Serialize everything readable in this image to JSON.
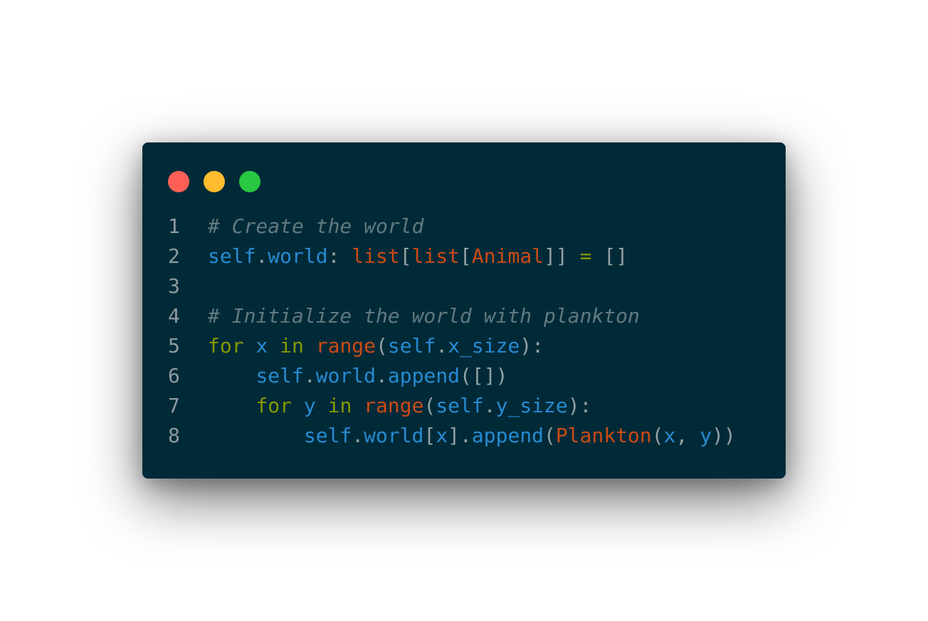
{
  "colors": {
    "window_bg": "#012a38",
    "close": "#ff5f57",
    "minimize": "#febc2e",
    "maximize": "#28c840",
    "line_number": "#8e9a9e",
    "comment": "#61797f",
    "identifier": "#268bd2",
    "punctuation": "#93a1a1",
    "keyword": "#859900",
    "builtin": "#cb4b16"
  },
  "window_controls": [
    {
      "name": "close-button",
      "icon": "red-circle-icon",
      "color": "#ff5f57"
    },
    {
      "name": "minimize-button",
      "icon": "yellow-circle-icon",
      "color": "#febc2e"
    },
    {
      "name": "maximize-button",
      "icon": "green-circle-icon",
      "color": "#28c840"
    }
  ],
  "lines": [
    {
      "num": "1",
      "tokens": [
        {
          "t": "# Create the world",
          "c": "comment"
        }
      ]
    },
    {
      "num": "2",
      "tokens": [
        {
          "t": "self",
          "c": "ident"
        },
        {
          "t": ".",
          "c": "punct"
        },
        {
          "t": "world",
          "c": "ident"
        },
        {
          "t": ": ",
          "c": "punct"
        },
        {
          "t": "list",
          "c": "builtin"
        },
        {
          "t": "[",
          "c": "punct"
        },
        {
          "t": "list",
          "c": "builtin"
        },
        {
          "t": "[",
          "c": "punct"
        },
        {
          "t": "Animal",
          "c": "builtin"
        },
        {
          "t": "]] ",
          "c": "punct"
        },
        {
          "t": "=",
          "c": "kw"
        },
        {
          "t": " []",
          "c": "punct"
        }
      ]
    },
    {
      "num": "3",
      "tokens": []
    },
    {
      "num": "4",
      "tokens": [
        {
          "t": "# Initialize the world with plankton",
          "c": "comment"
        }
      ]
    },
    {
      "num": "5",
      "tokens": [
        {
          "t": "for",
          "c": "kw"
        },
        {
          "t": " ",
          "c": "punct"
        },
        {
          "t": "x",
          "c": "ident"
        },
        {
          "t": " ",
          "c": "punct"
        },
        {
          "t": "in",
          "c": "kw"
        },
        {
          "t": " ",
          "c": "punct"
        },
        {
          "t": "range",
          "c": "builtin"
        },
        {
          "t": "(",
          "c": "punct"
        },
        {
          "t": "self",
          "c": "ident"
        },
        {
          "t": ".",
          "c": "punct"
        },
        {
          "t": "x_size",
          "c": "ident"
        },
        {
          "t": "):",
          "c": "punct"
        }
      ]
    },
    {
      "num": "6",
      "tokens": [
        {
          "t": "    ",
          "c": "punct"
        },
        {
          "t": "self",
          "c": "ident"
        },
        {
          "t": ".",
          "c": "punct"
        },
        {
          "t": "world",
          "c": "ident"
        },
        {
          "t": ".",
          "c": "punct"
        },
        {
          "t": "append",
          "c": "ident"
        },
        {
          "t": "([])",
          "c": "punct"
        }
      ]
    },
    {
      "num": "7",
      "tokens": [
        {
          "t": "    ",
          "c": "punct"
        },
        {
          "t": "for",
          "c": "kw"
        },
        {
          "t": " ",
          "c": "punct"
        },
        {
          "t": "y",
          "c": "ident"
        },
        {
          "t": " ",
          "c": "punct"
        },
        {
          "t": "in",
          "c": "kw"
        },
        {
          "t": " ",
          "c": "punct"
        },
        {
          "t": "range",
          "c": "builtin"
        },
        {
          "t": "(",
          "c": "punct"
        },
        {
          "t": "self",
          "c": "ident"
        },
        {
          "t": ".",
          "c": "punct"
        },
        {
          "t": "y_size",
          "c": "ident"
        },
        {
          "t": "):",
          "c": "punct"
        }
      ]
    },
    {
      "num": "8",
      "tokens": [
        {
          "t": "        ",
          "c": "punct"
        },
        {
          "t": "self",
          "c": "ident"
        },
        {
          "t": ".",
          "c": "punct"
        },
        {
          "t": "world",
          "c": "ident"
        },
        {
          "t": "[",
          "c": "punct"
        },
        {
          "t": "x",
          "c": "ident"
        },
        {
          "t": "].",
          "c": "punct"
        },
        {
          "t": "append",
          "c": "ident"
        },
        {
          "t": "(",
          "c": "punct"
        },
        {
          "t": "Plankton",
          "c": "builtin"
        },
        {
          "t": "(",
          "c": "punct"
        },
        {
          "t": "x",
          "c": "ident"
        },
        {
          "t": ", ",
          "c": "punct"
        },
        {
          "t": "y",
          "c": "ident"
        },
        {
          "t": "))",
          "c": "punct"
        }
      ]
    }
  ]
}
